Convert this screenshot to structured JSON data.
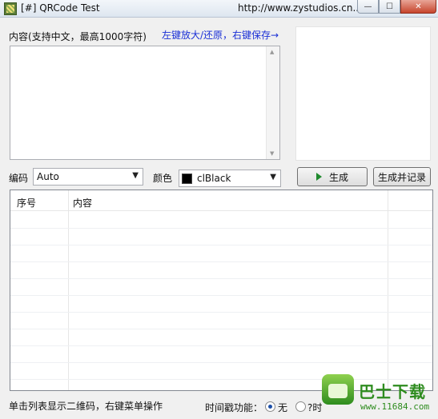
{
  "window": {
    "title": "[#] QRCode Test",
    "url": "http://www.zystudios.cn...",
    "controls": {
      "minimize": "—",
      "maximize": "☐",
      "close": "✕"
    }
  },
  "input": {
    "label": "内容(支持中文，最高1000字符)",
    "hint": "左键放大/还原，右键保存→",
    "value": ""
  },
  "encoding": {
    "label": "编码",
    "selected": "Auto"
  },
  "color": {
    "label": "颜色",
    "selected": "clBlack",
    "swatch": "#000000"
  },
  "buttons": {
    "generate": "生成",
    "generate_record": "生成并记录"
  },
  "table": {
    "columns": [
      "序号",
      "内容"
    ],
    "rows": []
  },
  "status": {
    "hint": "单击列表显示二维码，右键菜单操作",
    "timestamp_label": "时间戳功能：",
    "options": [
      {
        "label": "无",
        "checked": true
      },
      {
        "label": "?时",
        "checked": false
      }
    ]
  },
  "watermark": {
    "brand": "巴士下载",
    "url": "www.11684.com"
  }
}
